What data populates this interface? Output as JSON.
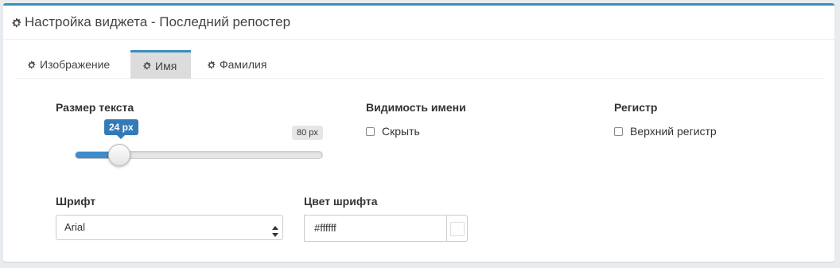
{
  "panel": {
    "title": "Настройка виджета - Последний репостер",
    "accent_color": "#3c8dbc"
  },
  "tabs": [
    {
      "label": "Изображение",
      "icon": "gear-icon",
      "active": false
    },
    {
      "label": "Имя",
      "icon": "gear-icon",
      "active": true
    },
    {
      "label": "Фамилия",
      "icon": "gear-icon",
      "active": false
    }
  ],
  "text_size": {
    "label": "Размер текста",
    "value_label": "24 px",
    "max_label": "80 px",
    "value": 24,
    "min": 0,
    "max": 80,
    "fill_color": "#428bca"
  },
  "name_visibility": {
    "label": "Видимость имени",
    "option_label": "Скрыть",
    "checked": false
  },
  "case": {
    "label": "Регистр",
    "option_label": "Верхний регистр",
    "checked": false
  },
  "font": {
    "label": "Шрифт",
    "selected": "Arial"
  },
  "font_color": {
    "label": "Цвет шрифта",
    "value": "#ffffff",
    "swatch_color": "#ffffff"
  }
}
